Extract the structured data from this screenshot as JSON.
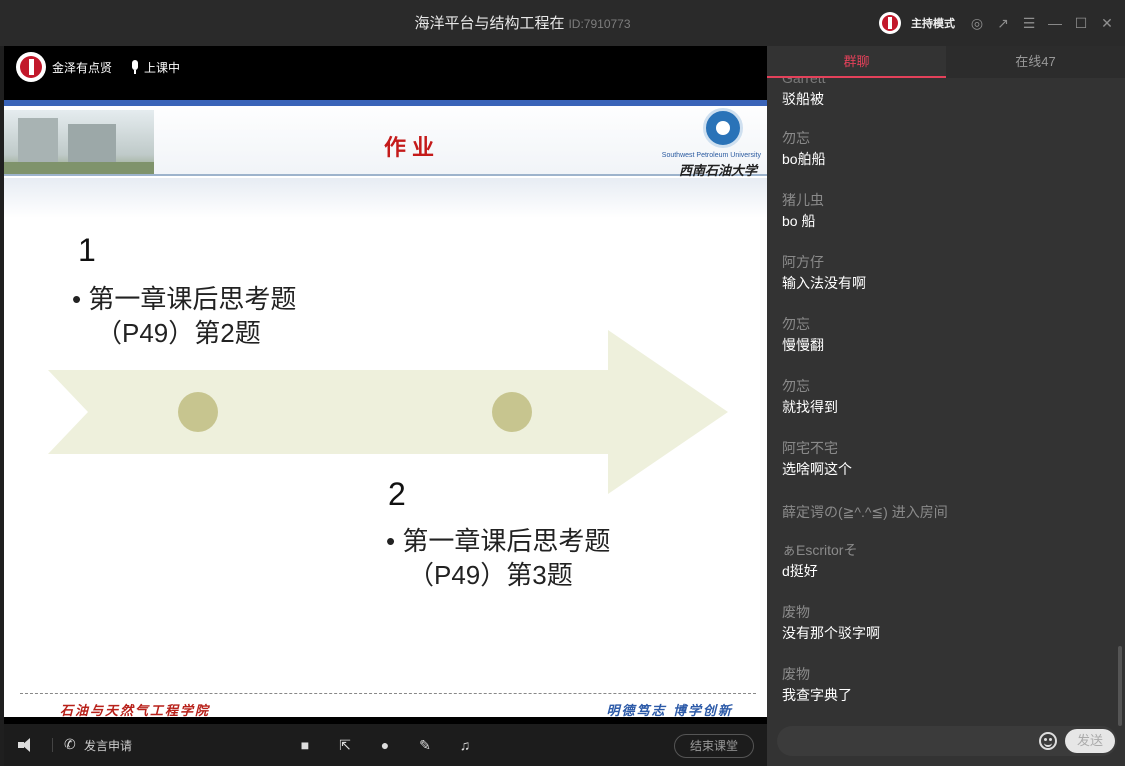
{
  "window": {
    "title": "海洋平台与结构工程在",
    "room_id": "ID:7910773",
    "host_mode_label": "主持模式"
  },
  "info_bar": {
    "teacher_name": "金泽有点贤",
    "status": "上课中"
  },
  "slide": {
    "title": "作业",
    "university_en": "Southwest Petroleum University",
    "university_cn": "西南石油大学",
    "item1_number": "1",
    "item1_line1": "• 第一章课后思考题",
    "item1_line2": "（P49）第2题",
    "item2_number": "2",
    "item2_line1": "• 第一章课后思考题",
    "item2_line2": "（P49）第3题",
    "footer_left": "石油与天然气工程学院",
    "footer_right": "明德笃志  博学创新"
  },
  "bottombar": {
    "speak_request": "发言申请",
    "end_class": "结束课堂"
  },
  "chat": {
    "tabs": [
      {
        "label": "群聊"
      },
      {
        "label": "在线47"
      }
    ],
    "partial_sender": "Garrett",
    "messages": [
      {
        "sender": "",
        "text": "驳船被"
      },
      {
        "sender": "勿忘",
        "text": "bo舶船"
      },
      {
        "sender": "猪儿虫",
        "text": "bo 船"
      },
      {
        "sender": "阿方仔",
        "text": "输入法没有啊"
      },
      {
        "sender": "勿忘",
        "text": "慢慢翻"
      },
      {
        "sender": "勿忘",
        "text": "就找得到"
      },
      {
        "sender": "阿宅不宅",
        "text": "选啥啊这个"
      },
      {
        "sender": "ぁEscritorそ",
        "text": "d挺好"
      },
      {
        "sender": "废物",
        "text": "没有那个驳字啊"
      },
      {
        "sender": "废物",
        "text": "我查字典了"
      }
    ],
    "system_message": "薛定谔の(≧^.^≦) 进入房间",
    "input_placeholder": "",
    "send_label": "发送"
  },
  "colors": {
    "accent": "#e4415a",
    "background": "#333333",
    "slide_title": "#c41a1a"
  }
}
